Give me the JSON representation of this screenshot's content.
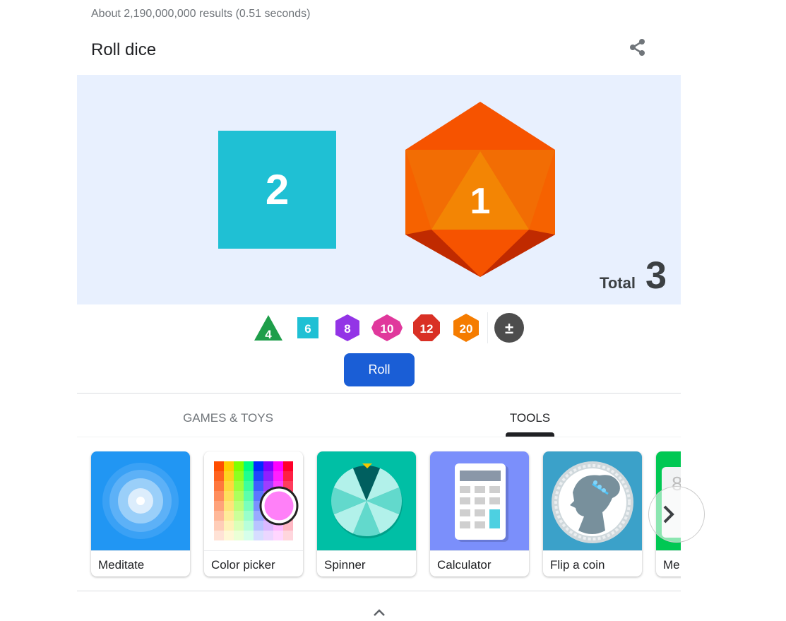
{
  "search": {
    "result_stats": "About 2,190,000,000 results (0.51 seconds)"
  },
  "widget": {
    "title": "Roll dice",
    "share_icon": "share-icon",
    "rolled_dice": [
      {
        "type": "d6",
        "value": "2",
        "color": "#1fc0d4"
      },
      {
        "type": "d20",
        "value": "1",
        "color": "#f57c00"
      }
    ],
    "total_label": "Total",
    "total_value": "3",
    "dice_options": [
      {
        "label": "4",
        "type": "d4",
        "color": "#1e9e4a"
      },
      {
        "label": "6",
        "type": "d6",
        "color": "#1fc0d4"
      },
      {
        "label": "8",
        "type": "d8",
        "color": "#9334e6"
      },
      {
        "label": "10",
        "type": "d10",
        "color": "#e0389c"
      },
      {
        "label": "12",
        "type": "d12",
        "color": "#d93025"
      },
      {
        "label": "20",
        "type": "d20",
        "color": "#f57c00"
      },
      {
        "label": "±",
        "type": "modifier",
        "color": "#4d4d4d"
      }
    ],
    "roll_label": "Roll",
    "roll_color": "#1a5ed6"
  },
  "tabs": [
    {
      "label": "GAMES & TOYS",
      "active": false
    },
    {
      "label": "TOOLS",
      "active": true
    }
  ],
  "tools": [
    {
      "label": "Meditate",
      "icon": "meditate-icon",
      "bg": "#2196f3"
    },
    {
      "label": "Color picker",
      "icon": "color-picker-icon",
      "bg": "#ffffff"
    },
    {
      "label": "Spinner",
      "icon": "spinner-icon",
      "bg": "#00bfa5"
    },
    {
      "label": "Calculator",
      "icon": "calculator-icon",
      "bg": "#7b8ffb"
    },
    {
      "label": "Flip a coin",
      "icon": "coin-icon",
      "bg": "#3ba1c9"
    },
    {
      "label": "Me",
      "icon": "metronome-icon",
      "bg": "#00c853"
    }
  ],
  "carousel": {
    "next_icon": "chevron-right-icon",
    "collapse_icon": "chevron-up-icon"
  }
}
